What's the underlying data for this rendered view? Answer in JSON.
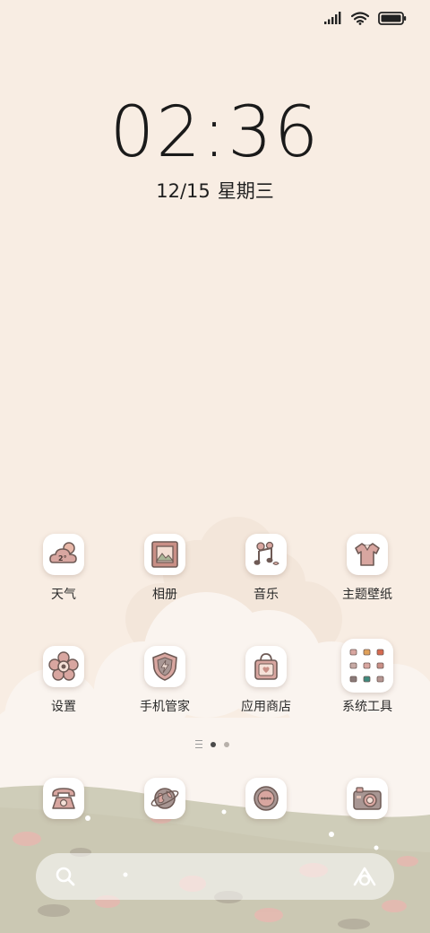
{
  "status_bar": {
    "signal_icon": "signal-bars-icon",
    "wifi_icon": "wifi-icon",
    "battery_icon": "battery-full-icon"
  },
  "clock": {
    "time": "02:36"
  },
  "date": {
    "date": "12/15",
    "weekday": "星期三"
  },
  "apps": [
    {
      "label": "天气",
      "icon": "weather-cloud-icon"
    },
    {
      "label": "相册",
      "icon": "photo-frame-icon"
    },
    {
      "label": "音乐",
      "icon": "music-note-icon"
    },
    {
      "label": "主题壁纸",
      "icon": "shirt-icon"
    },
    {
      "label": "设置",
      "icon": "gear-flower-icon"
    },
    {
      "label": "手机管家",
      "icon": "shield-bolt-icon"
    },
    {
      "label": "应用商店",
      "icon": "shopping-bag-icon"
    },
    {
      "label": "系统工具",
      "icon": "folder-grid-icon"
    }
  ],
  "weather_tile_text": "2°",
  "pager": {
    "pages": 2,
    "current": 1
  },
  "dock": [
    {
      "icon": "phone-icon"
    },
    {
      "icon": "browser-globe-icon"
    },
    {
      "icon": "messages-icon"
    },
    {
      "icon": "camera-icon"
    }
  ],
  "search_bar": {
    "search_icon": "search-icon",
    "assistant_icon": "assistant-icon"
  },
  "colors": {
    "background": "#f8ede3",
    "icon_line": "#6e5a55",
    "icon_pink": "#d8a6a0"
  }
}
